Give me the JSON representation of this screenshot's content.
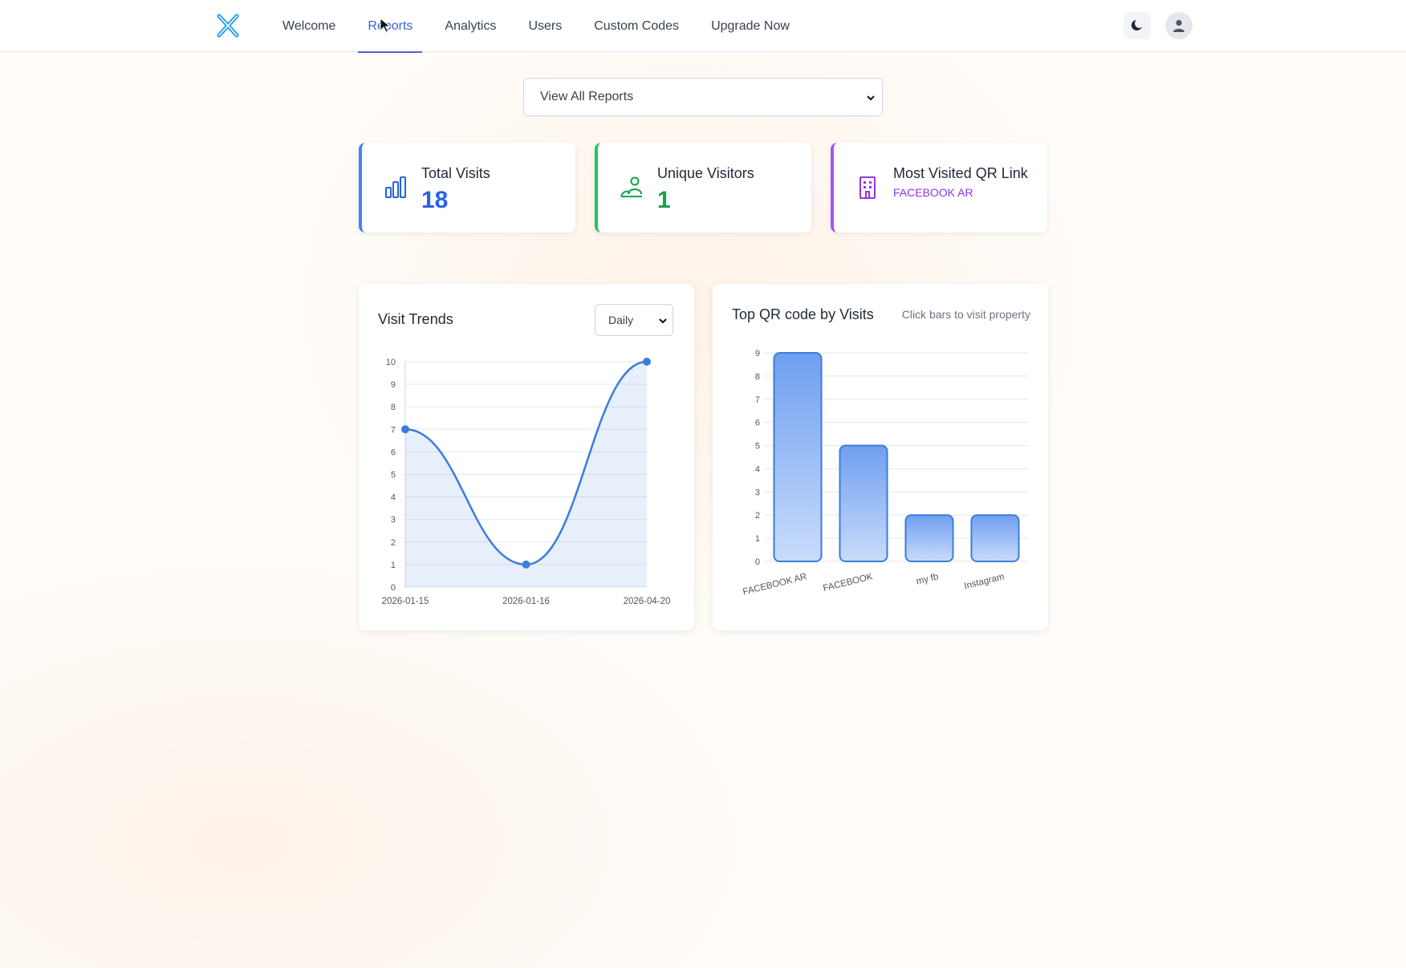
{
  "nav": {
    "items": [
      {
        "label": "Welcome",
        "active": false
      },
      {
        "label": "Reports",
        "active": true
      },
      {
        "label": "Analytics",
        "active": false
      },
      {
        "label": "Users",
        "active": false
      },
      {
        "label": "Custom Codes",
        "active": false
      },
      {
        "label": "Upgrade Now",
        "active": false
      }
    ],
    "logo_icon": "x-logo-icon",
    "theme_icon": "moon-icon",
    "avatar_icon": "user-icon"
  },
  "report_select": {
    "value": "View All Reports"
  },
  "stats": [
    {
      "label": "Total Visits",
      "value": "18",
      "color": "#2563eb",
      "icon": "bar-chart-icon"
    },
    {
      "label": "Unique Visitors",
      "value": "1",
      "color": "#16a34a",
      "icon": "users-icon"
    },
    {
      "label": "Most Visited QR Link",
      "value": "FACEBOOK AR",
      "color": "#9333ea",
      "icon": "building-icon"
    }
  ],
  "visit_trends": {
    "title": "Visit Trends",
    "period": "Daily"
  },
  "top_qr": {
    "title": "Top QR code by Visits",
    "hint": "Click bars to visit property"
  },
  "chart_data": [
    {
      "type": "line",
      "title": "Visit Trends",
      "x": [
        "2026-01-15",
        "2026-01-16",
        "2026-04-20"
      ],
      "values": [
        7,
        1,
        10
      ],
      "ylim": [
        0,
        10
      ],
      "yticks": [
        0,
        1,
        2,
        3,
        4,
        5,
        6,
        7,
        8,
        9,
        10
      ],
      "grid": true,
      "color": "#3b7ddd"
    },
    {
      "type": "bar",
      "title": "Top QR code by Visits",
      "categories": [
        "FACEBOOK AR",
        "FACEBOOK",
        "my fb",
        "Instagram"
      ],
      "values": [
        9,
        5,
        2,
        2
      ],
      "ylim": [
        0,
        9
      ],
      "yticks": [
        0,
        1,
        2,
        3,
        4,
        5,
        6,
        7,
        8,
        9
      ],
      "grid": true,
      "color": "#3b7ddd"
    }
  ]
}
